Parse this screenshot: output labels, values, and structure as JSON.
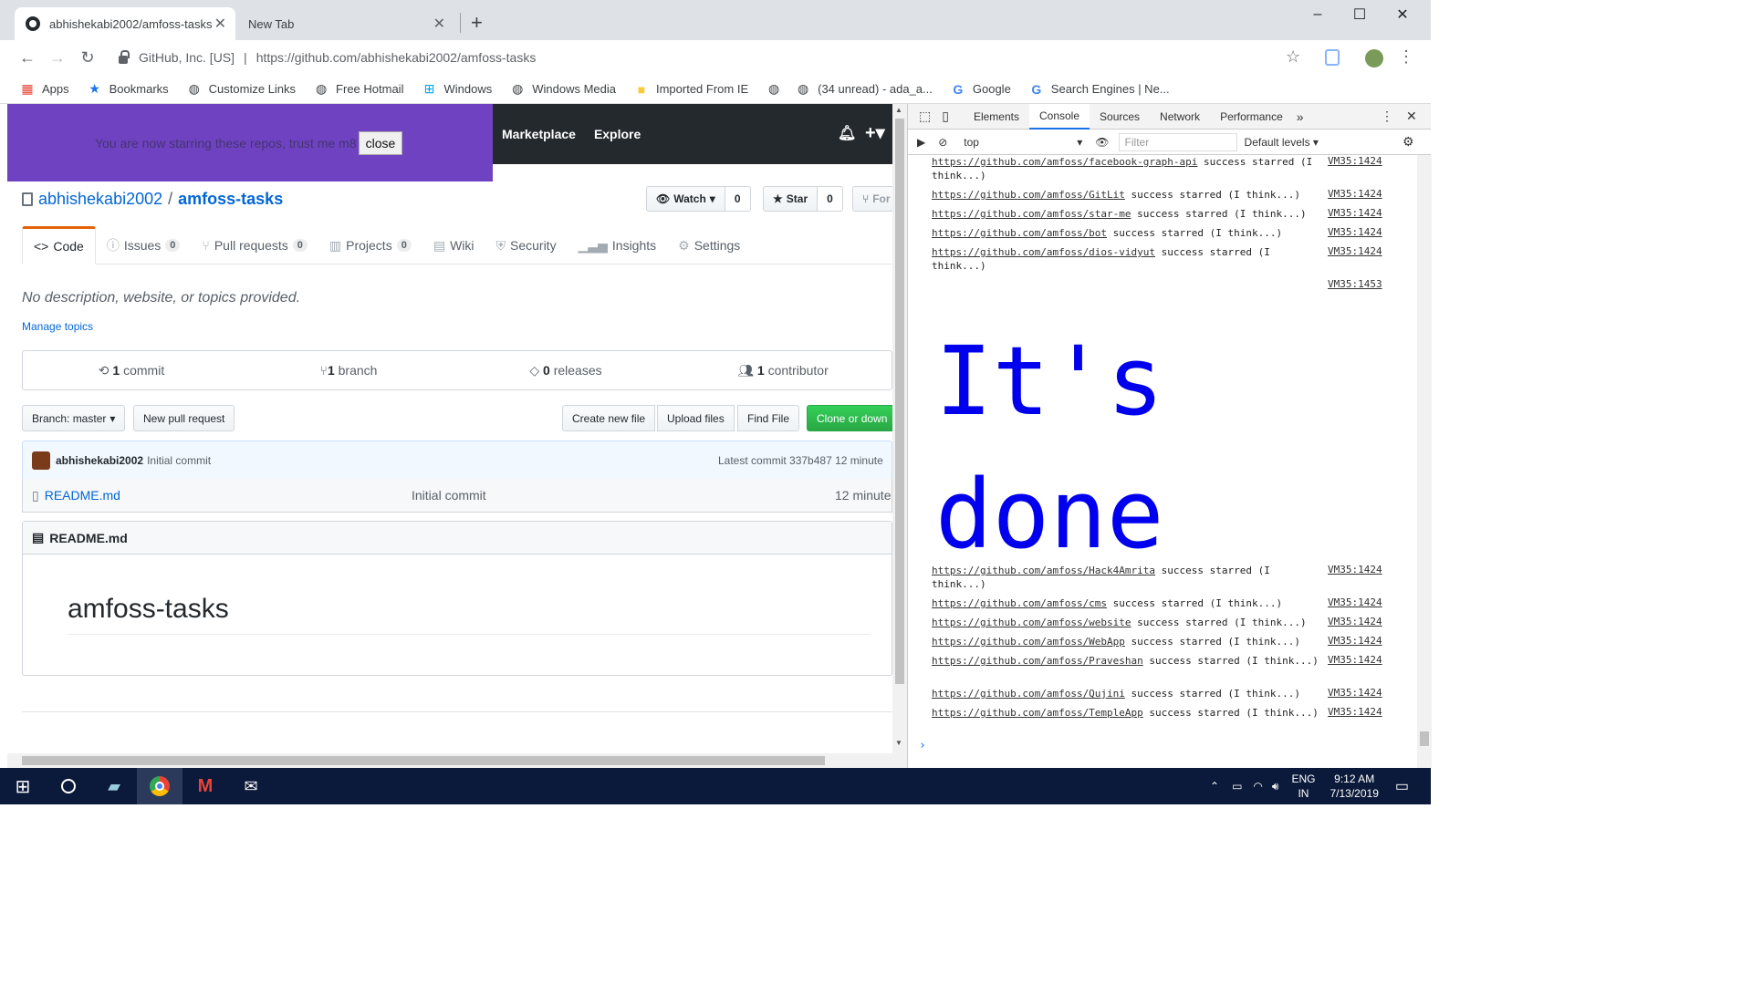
{
  "browser": {
    "tabs": [
      {
        "title": "abhishekabi2002/amfoss-tasks"
      },
      {
        "title": "New Tab"
      }
    ],
    "site_identity": "GitHub, Inc. [US]",
    "url_prefix": "https://github.com/",
    "url_path": "abhishekabi2002/amfoss-tasks",
    "bookmarks": [
      {
        "label": "Apps",
        "icon": "apps-grid-icon"
      },
      {
        "label": "Bookmarks",
        "icon": "star-icon"
      },
      {
        "label": "Customize Links",
        "icon": "globe-icon"
      },
      {
        "label": "Free Hotmail",
        "icon": "globe-icon"
      },
      {
        "label": "Windows",
        "icon": "windows-icon"
      },
      {
        "label": "Windows Media",
        "icon": "globe-icon"
      },
      {
        "label": "Imported From IE",
        "icon": "folder-icon"
      },
      {
        "label": "",
        "icon": "globe-icon"
      },
      {
        "label": "(34 unread) - ada_a...",
        "icon": "globe-icon"
      },
      {
        "label": "Google",
        "icon": "google-icon"
      },
      {
        "label": "Search Engines | Ne...",
        "icon": "google-icon"
      }
    ]
  },
  "banner": {
    "message": "You are now starring these repos, trust me m8",
    "close_label": "close",
    "color": "#6f42c1"
  },
  "github_header": {
    "links": [
      "Marketplace",
      "Explore"
    ]
  },
  "repo": {
    "owner": "abhishekabi2002",
    "name": "amfoss-tasks",
    "watch_label": "Watch",
    "watch_count": "0",
    "star_label": "Star",
    "star_count": "0",
    "fork_label": "For",
    "nav": [
      {
        "label": "Code",
        "count": ""
      },
      {
        "label": "Issues",
        "count": "0"
      },
      {
        "label": "Pull requests",
        "count": "0"
      },
      {
        "label": "Projects",
        "count": "0"
      },
      {
        "label": "Wiki",
        "count": ""
      },
      {
        "label": "Security",
        "count": ""
      },
      {
        "label": "Insights",
        "count": ""
      },
      {
        "label": "Settings",
        "count": ""
      }
    ],
    "description": "No description, website, or topics provided.",
    "manage_topics": "Manage topics",
    "summary": [
      {
        "count": "1",
        "label": "commit"
      },
      {
        "count": "1",
        "label": "branch"
      },
      {
        "count": "0",
        "label": "releases"
      },
      {
        "count": "1",
        "label": "contributor"
      }
    ],
    "branch_label": "Branch: master",
    "new_pr": "New pull request",
    "create_file": "Create new file",
    "upload_files": "Upload files",
    "find_file": "Find File",
    "clone_label": "Clone or down",
    "commit_author": "abhishekabi2002",
    "commit_message": "Initial commit",
    "latest_commit": "Latest commit 337b487 12 minute",
    "files": [
      {
        "name": "README.md",
        "message": "Initial commit",
        "age": "12 minute"
      }
    ],
    "readme_title": "README.md",
    "readme_heading": "amfoss-tasks"
  },
  "devtools": {
    "tabs": [
      "Elements",
      "Console",
      "Sources",
      "Network",
      "Performance"
    ],
    "context": "top",
    "filter_placeholder": "Filter",
    "levels": "Default levels",
    "big_message": "It's done",
    "logs_before": [
      {
        "url": "https://github.com/amfoss/facebook-graph-api",
        "msg": " success starred (I think...)",
        "src": "VM35:1424",
        "lines": 2
      },
      {
        "url": "https://github.com/amfoss/GitLit",
        "msg": " success starred (I think...)",
        "src": "VM35:1424",
        "lines": 1
      },
      {
        "url": "https://github.com/amfoss/star-me",
        "msg": " success starred (I think...)",
        "src": "VM35:1424",
        "lines": 1
      },
      {
        "url": "https://github.com/amfoss/bot",
        "msg": " success starred (I think...)",
        "src": "VM35:1424",
        "lines": 1
      },
      {
        "url": "https://github.com/amfoss/dios-vidyut",
        "msg": " success starred (I think...)",
        "src": "VM35:1424",
        "lines": 2
      }
    ],
    "big_src": "VM35:1453",
    "logs_after": [
      {
        "url": "https://github.com/amfoss/Hack4Amrita",
        "msg": " success starred (I think...)",
        "src": "VM35:1424",
        "lines": 2
      },
      {
        "url": "https://github.com/amfoss/cms",
        "msg": " success starred (I think...)",
        "src": "VM35:1424",
        "lines": 1
      },
      {
        "url": "https://github.com/amfoss/website",
        "msg": " success starred (I think...)",
        "src": "VM35:1424",
        "lines": 1
      },
      {
        "url": "https://github.com/amfoss/WebApp",
        "msg": " success starred (I think...)",
        "src": "VM35:1424",
        "lines": 1
      },
      {
        "url": "https://github.com/amfoss/Praveshan",
        "msg": " success starred (I think...)",
        "src": "VM35:1424",
        "lines": 2
      },
      {
        "url": "https://github.com/amfoss/Qujini",
        "msg": " success starred (I think...)",
        "src": "VM35:1424",
        "lines": 1
      },
      {
        "url": "https://github.com/amfoss/TempleApp",
        "msg": " success starred (I think...)",
        "src": "VM35:1424",
        "lines": 2
      }
    ]
  },
  "taskbar": {
    "language": "ENG",
    "region": "IN",
    "time": "9:12 AM",
    "date": "7/13/2019"
  }
}
